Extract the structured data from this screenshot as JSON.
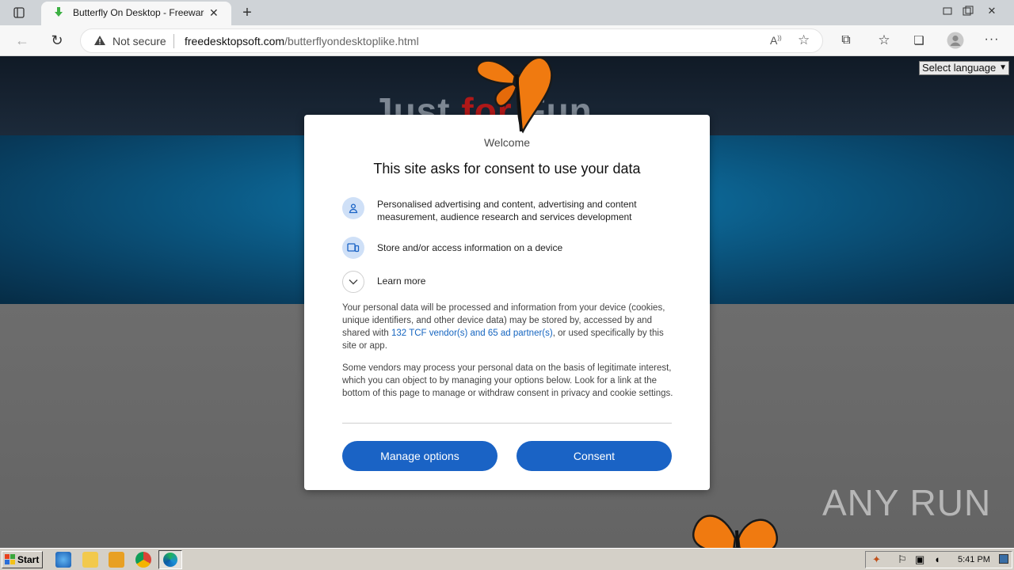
{
  "browser": {
    "tab_title": "Butterfly On Desktop - Freeware",
    "security_label": "Not secure",
    "url_domain": "freedesktopsoft.com",
    "url_path": "/butterflyondesktoplike.html"
  },
  "page": {
    "brand_part1": "Just",
    "brand_part2": "for",
    "brand_part3": "Fun",
    "language_select": "Select language"
  },
  "consent": {
    "welcome": "Welcome",
    "title": "This site asks for consent to use your data",
    "purposes": [
      {
        "icon": "person-icon",
        "text": "Personalised advertising and content, advertising and content measurement, audience research and services development"
      },
      {
        "icon": "device-icon",
        "text": "Store and/or access information on a device"
      }
    ],
    "learn_more": "Learn more",
    "para1_before": "Your personal data will be processed and information from your device (cookies, unique identifiers, and other device data) may be stored by, accessed by and shared with ",
    "para1_link": "132 TCF vendor(s) and 65 ad partner(s)",
    "para1_after": ", or used specifically by this site or app.",
    "para2": "Some vendors may process your personal data on the basis of legitimate interest, which you can object to by managing your options below. Look for a link at the bottom of this page to manage or withdraw consent in privacy and cookie settings.",
    "manage_button": "Manage options",
    "consent_button": "Consent"
  },
  "watermark": "ANY RUN",
  "taskbar": {
    "start_label": "Start",
    "clock": "5:41 PM"
  },
  "colors": {
    "accent": "#1a63c5",
    "link": "#1565c0",
    "brand_red": "#b01818"
  }
}
